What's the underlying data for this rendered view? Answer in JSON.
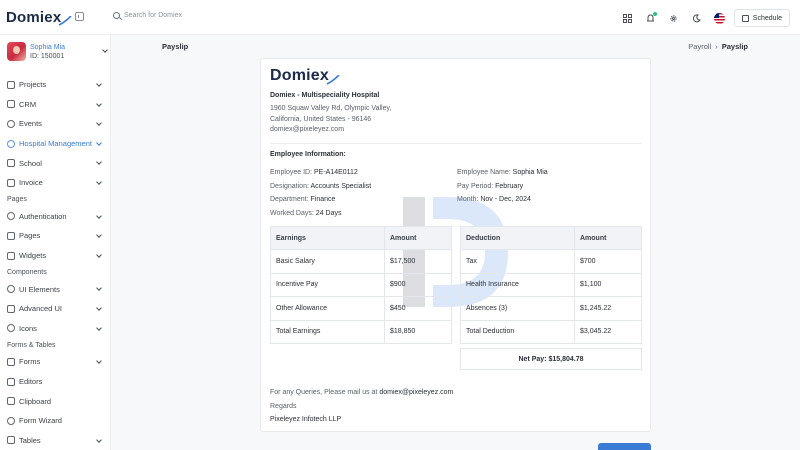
{
  "app": {
    "logo_text": "Domiex"
  },
  "search": {
    "placeholder": "Search for Domiex"
  },
  "topbar": {
    "schedule_label": "Schedule"
  },
  "user": {
    "name": "Sophia Mia",
    "id": "ID: 150001"
  },
  "sidebar": {
    "items": [
      {
        "label": "Projects",
        "icon": "monitor-icon",
        "chevron": true
      },
      {
        "label": "CRM",
        "icon": "shopping-bag-icon",
        "chevron": true
      },
      {
        "label": "Events",
        "icon": "trophy-icon",
        "chevron": true
      },
      {
        "label": "Hospital Management",
        "icon": "stethoscope-icon",
        "chevron": true,
        "active": true
      },
      {
        "label": "School",
        "icon": "school-icon",
        "chevron": true
      },
      {
        "label": "Invoice",
        "icon": "file-icon",
        "chevron": true
      }
    ],
    "section_pages": "Pages",
    "pages_items": [
      {
        "label": "Authentication",
        "icon": "users-icon",
        "chevron": true
      },
      {
        "label": "Pages",
        "icon": "book-icon",
        "chevron": true
      },
      {
        "label": "Widgets",
        "icon": "widgets-icon",
        "chevron": true
      }
    ],
    "section_components": "Components",
    "component_items": [
      {
        "label": "UI Elements",
        "icon": "shapes-icon",
        "chevron": true
      },
      {
        "label": "Advanced UI",
        "icon": "gem-icon",
        "chevron": true
      },
      {
        "label": "Icons",
        "icon": "icons-icon",
        "chevron": true
      }
    ],
    "section_forms": "Forms & Tables",
    "form_items": [
      {
        "label": "Forms",
        "icon": "book-open-icon",
        "chevron": true
      },
      {
        "label": "Editors",
        "icon": "editor-icon",
        "chevron": false
      },
      {
        "label": "Clipboard",
        "icon": "clipboard-icon",
        "chevron": false
      },
      {
        "label": "Form Wizard",
        "icon": "wizard-icon",
        "chevron": false
      },
      {
        "label": "Tables",
        "icon": "table-icon",
        "chevron": true
      }
    ]
  },
  "page": {
    "title": "Payslip",
    "breadcrumb_parent": "Payroll",
    "breadcrumb_current": "Payslip"
  },
  "payslip": {
    "logo_text": "Domiex",
    "hospital_name": "Domiex - Multispeciality Hospital",
    "address_line1": "1960 Squaw Valley Rd, Olympic Valley,",
    "address_line2": "California, United States - 96146",
    "email": "domiex@pixeleyez.com",
    "employee_info_title": "Employee Information:",
    "employee_left": [
      {
        "label": "Employee ID:",
        "value": "PE-A14E0112"
      },
      {
        "label": "Designation:",
        "value": "Accounts Specialist"
      },
      {
        "label": "Department:",
        "value": "Finance"
      },
      {
        "label": "Worked Days:",
        "value": "24 Days"
      }
    ],
    "employee_right": [
      {
        "label": "Employee Name:",
        "value": "Sophia Mia"
      },
      {
        "label": "Pay Period:",
        "value": "February"
      },
      {
        "label": "Month:",
        "value": "Nov - Dec, 2024"
      }
    ],
    "earnings": {
      "headers": [
        "Earnings",
        "Amount"
      ],
      "rows": [
        [
          "Basic Salary",
          "$17,500"
        ],
        [
          "Incentive Pay",
          "$900"
        ],
        [
          "Other Allowance",
          "$450"
        ],
        [
          "Total Earnings",
          "$18,850"
        ]
      ]
    },
    "deductions": {
      "headers": [
        "Deduction",
        "Amount"
      ],
      "rows": [
        [
          "Tax",
          "$700"
        ],
        [
          "Health Insurance",
          "$1,100"
        ],
        [
          "Absences (3)",
          "$1,245.22"
        ],
        [
          "Total Deduction",
          "$3,045.22"
        ]
      ]
    },
    "net_pay": "Net Pay: $15,804.78",
    "queries_prefix": "For any Queries, Please mail us at",
    "queries_email": "domiex@pixeleyez.com",
    "regards": "Regards",
    "company": "Pixeleyez Infotech LLP"
  },
  "colors": {
    "accent": "#3a7bd5",
    "brand_dark": "#1b2a49"
  }
}
